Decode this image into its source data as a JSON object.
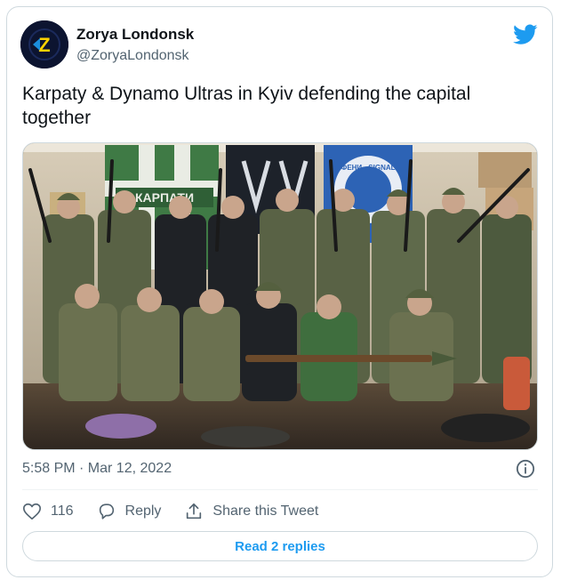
{
  "author": {
    "display_name": "Zorya Londonsk",
    "handle": "@ZoryaLondonsk",
    "avatar_letter": "Z"
  },
  "tweet": {
    "text": "Karpaty & Dynamo Ultras in Kyiv defending the capital together",
    "timestamp": "5:58 PM · Mar 12, 2022"
  },
  "photo": {
    "banner_left_text": "КАРПАТИ",
    "banner_right_text": "ФЕНИ · SIGNAL"
  },
  "actions": {
    "like_count": "116",
    "reply_label": "Reply",
    "share_label": "Share this Tweet"
  },
  "read_replies_label": "Read 2 replies",
  "colors": {
    "accent": "#1d9bf0",
    "muted": "#536471",
    "border": "#cfd9de"
  }
}
